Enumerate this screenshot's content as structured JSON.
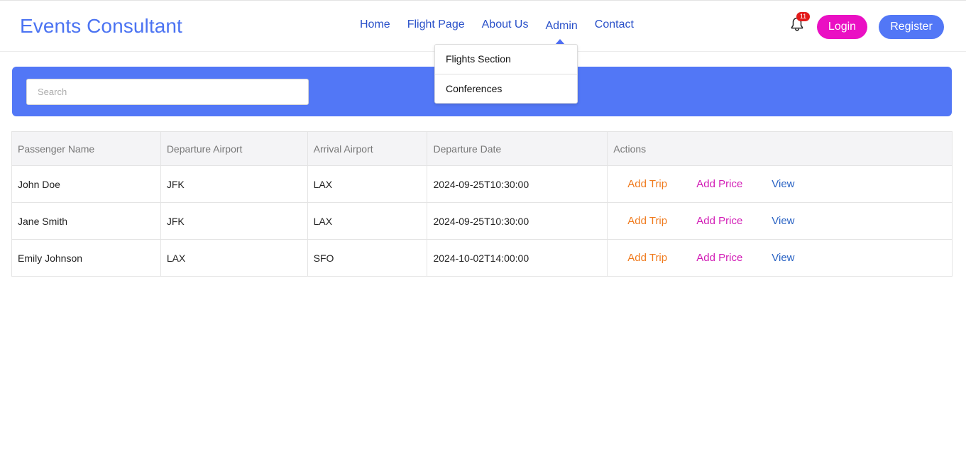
{
  "brand": "Events Consultant",
  "nav": {
    "items": [
      "Home",
      "Flight Page",
      "About Us",
      "Admin",
      "Contact"
    ],
    "active": "Admin"
  },
  "notifications": {
    "count": "11",
    "icon": "bell-icon"
  },
  "auth": {
    "login": "Login",
    "register": "Register"
  },
  "dropdown": {
    "items": [
      "Flights Section",
      "Conferences"
    ]
  },
  "search": {
    "placeholder": "Search",
    "value": ""
  },
  "table": {
    "columns": [
      "Passenger Name",
      "Departure Airport",
      "Arrival Airport",
      "Departure Date",
      "Actions"
    ],
    "rows": [
      {
        "name": "John Doe",
        "from": "JFK",
        "to": "LAX",
        "date": "2024-09-25T10:30:00"
      },
      {
        "name": "Jane Smith",
        "from": "JFK",
        "to": "LAX",
        "date": "2024-09-25T10:30:00"
      },
      {
        "name": "Emily Johnson",
        "from": "LAX",
        "to": "SFO",
        "date": "2024-10-02T14:00:00"
      }
    ],
    "actions": {
      "add_trip": "Add Trip",
      "add_price": "Add Price",
      "view": "View"
    }
  },
  "colors": {
    "brand": "#4b73f2",
    "nav_link": "#2a51c9",
    "login_bg": "#ea10c3",
    "register_bg": "#5277f6",
    "banner_bg": "#5277f6",
    "add_trip": "#f07b1e",
    "add_price": "#d21cb6",
    "view": "#2a63c4",
    "badge": "#e31b1b"
  }
}
